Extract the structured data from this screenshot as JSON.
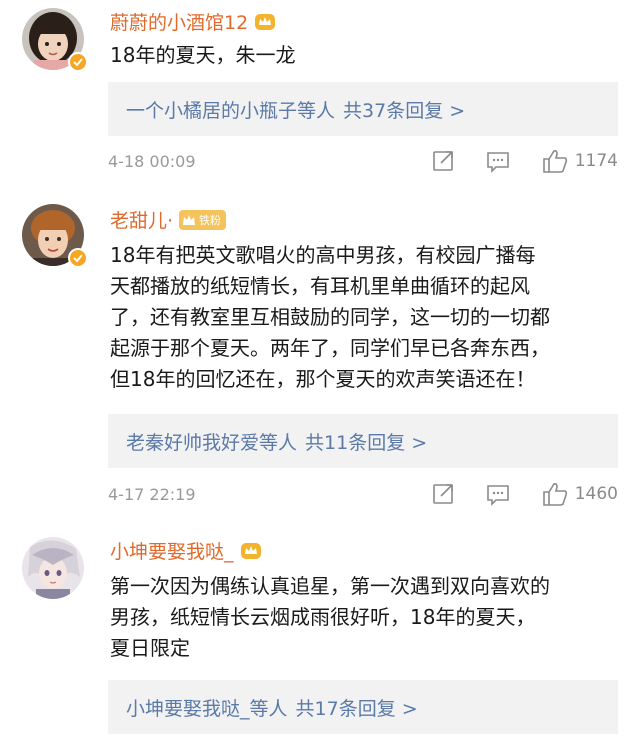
{
  "comments": [
    {
      "username": "蔚蔚的小酒馆12",
      "text": "18年的夏天，朱一龙",
      "reply_names": "一个小橘居的小瓶子等人",
      "reply_count": "共37条回复 >",
      "time": "4-18 00:09",
      "likes": "1174",
      "avatar_icon": "girl-avatar-icon"
    },
    {
      "username": "老甜儿·",
      "badge": "铁粉",
      "text": "18年有把英文歌唱火的高中男孩，有校园广播每\n天都播放的纸短情长，有耳机里单曲循环的起风\n了，还有教室里互相鼓励的同学，这一切的一切都\n起源于那个夏天。两年了，同学们早已各奔东西，\n但18年的回忆还在，那个夏天的欢声笑语还在！",
      "reply_names": "老秦好帅我好爱等人",
      "reply_count": "共11条回复 >",
      "time": "4-17 22:19",
      "likes": "1460",
      "avatar_icon": "boy-avatar-icon"
    },
    {
      "username": "小坤要娶我哒_",
      "text": "第一次因为偶练认真追星，第一次遇到双向喜欢的\n男孩，纸短情长云烟成雨很好听，18年的夏天，\n夏日限定",
      "reply_names": "小坤要娶我哒_等人",
      "reply_count": "共17条回复 >",
      "avatar_icon": "anime-avatar-icon"
    }
  ],
  "colors": {
    "username": "#e06a2c",
    "reply_link": "#5b7aa8",
    "reply_bg": "#f2f2f2",
    "meta": "#9a9a9a",
    "verified": "#f6a623"
  }
}
